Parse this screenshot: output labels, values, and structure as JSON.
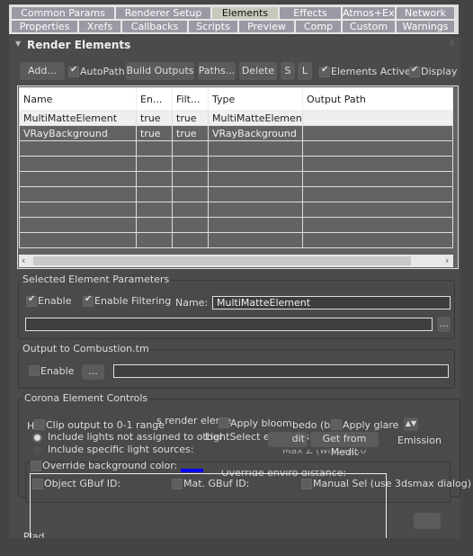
{
  "tabs_row1": [
    "Common Params",
    "Renderer Setup",
    "Elements",
    "Effects",
    "Atmos+Exp",
    "Network"
  ],
  "tabs_row2": [
    "Properties",
    "Xrefs",
    "Callbacks",
    "Scripts",
    "Preview",
    "Comp",
    "Custom",
    "Warnings"
  ],
  "active_tab": "Elements",
  "rollout": {
    "title": "Render Elements"
  },
  "toolbar": {
    "add": "Add...",
    "autopath": "AutoPath",
    "autopath_checked": true,
    "build_outputs": "Build Outputs",
    "paths": "Paths...",
    "delete": "Delete",
    "s": "S",
    "l": "L",
    "elements_active": "Elements Active",
    "elements_active_checked": true,
    "display": "Display",
    "display_checked": true
  },
  "table": {
    "columns": [
      "Name",
      "En...",
      "Filt...",
      "Type",
      "Output Path"
    ],
    "rows": [
      [
        "MultiMatteElement",
        "true",
        "true",
        "MultiMatteElement",
        ""
      ],
      [
        "VRayBackground",
        "true",
        "true",
        "VRayBackground",
        ""
      ]
    ]
  },
  "selected_params": {
    "title": "Selected Element Parameters",
    "enable": "Enable",
    "enable_filtering": "Enable Filtering",
    "name_label": "Name:",
    "name_value": "MultiMatteElement",
    "browse": "..."
  },
  "combustion": {
    "title": "Output to Combustion.tm",
    "enable": "Enable",
    "browse": "..."
  },
  "corona": {
    "title": "Corona Element Controls",
    "clip": "Clip output to 0-1 range",
    "render_elem": "s render eleme",
    "apply_bloom": "Apply bloom",
    "albedo": "bedo (bl",
    "apply_glare": "Apply glare",
    "include_lights": "Include lights not assigned to other",
    "lightselect": "LightSelect elements",
    "dit": "dit",
    "get_from_medit": "Get from Medit",
    "emission": "Emission",
    "include_specific": "Include specific light sources:",
    "max_z": "Max Z (white):",
    "max_z_value": "0,0",
    "override_bg": "Override background color:",
    "override_enviro": "Override enviro distance:",
    "bg_color": "#0000ff",
    "object_gbuf": "Object GBuf ID:",
    "mat_gbuf": "Mat. GBuf ID:",
    "manual_sel": "Manual Sel (use 3dsmax dialog)",
    "h": "H"
  },
  "next_rollout": "Plad"
}
